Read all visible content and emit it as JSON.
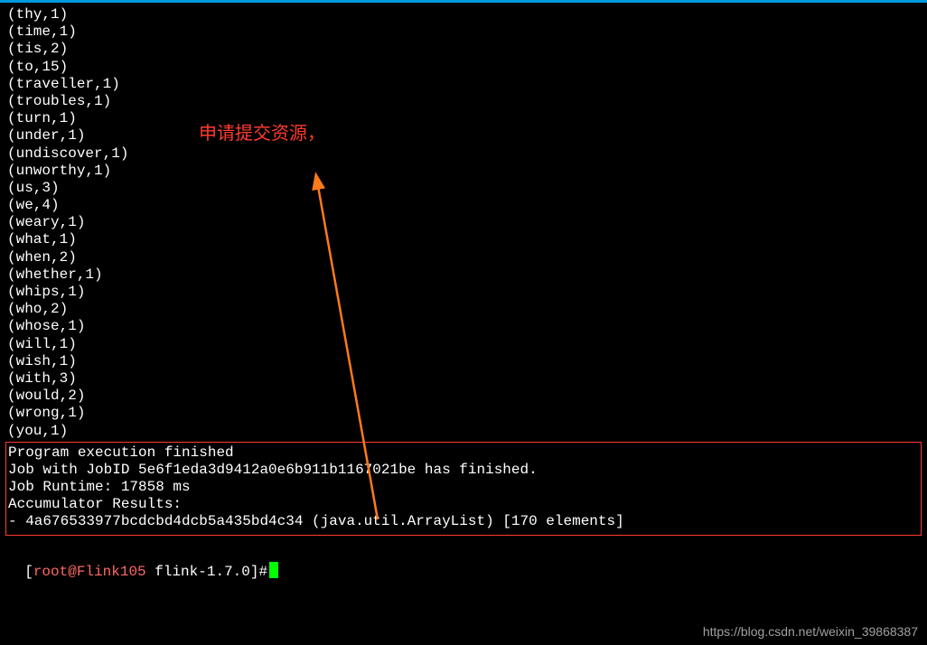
{
  "output_lines": [
    "(thy,1)",
    "(time,1)",
    "(tis,2)",
    "(to,15)",
    "(traveller,1)",
    "(troubles,1)",
    "(turn,1)",
    "(under,1)",
    "(undiscover,1)",
    "(unworthy,1)",
    "(us,3)",
    "(we,4)",
    "(weary,1)",
    "(what,1)",
    "(when,2)",
    "(whether,1)",
    "(whips,1)",
    "(who,2)",
    "(whose,1)",
    "(will,1)",
    "(wish,1)",
    "(with,3)",
    "(would,2)",
    "(wrong,1)",
    "(you,1)"
  ],
  "result_lines": [
    "Program execution finished",
    "Job with JobID 5e6f1eda3d9412a0e6b911b1167021be has finished.",
    "Job Runtime: 17858 ms",
    "Accumulator Results:",
    "- 4a676533977bcdcbd4dcb5a435bd4c34 (java.util.ArrayList) [170 elements]"
  ],
  "prompt": {
    "open": "[",
    "user": "root",
    "at": "@",
    "host": "Flink105",
    "space": " ",
    "path": "flink-1.7.0",
    "close": "]",
    "hash": "#"
  },
  "annotation": "申请提交资源，",
  "watermark": "https://blog.csdn.net/weixin_39868387",
  "colors": {
    "annotation": "#ff3b30",
    "box_border": "#ff3b30",
    "cursor": "#00ff00",
    "title_bar": "#0099dd"
  }
}
